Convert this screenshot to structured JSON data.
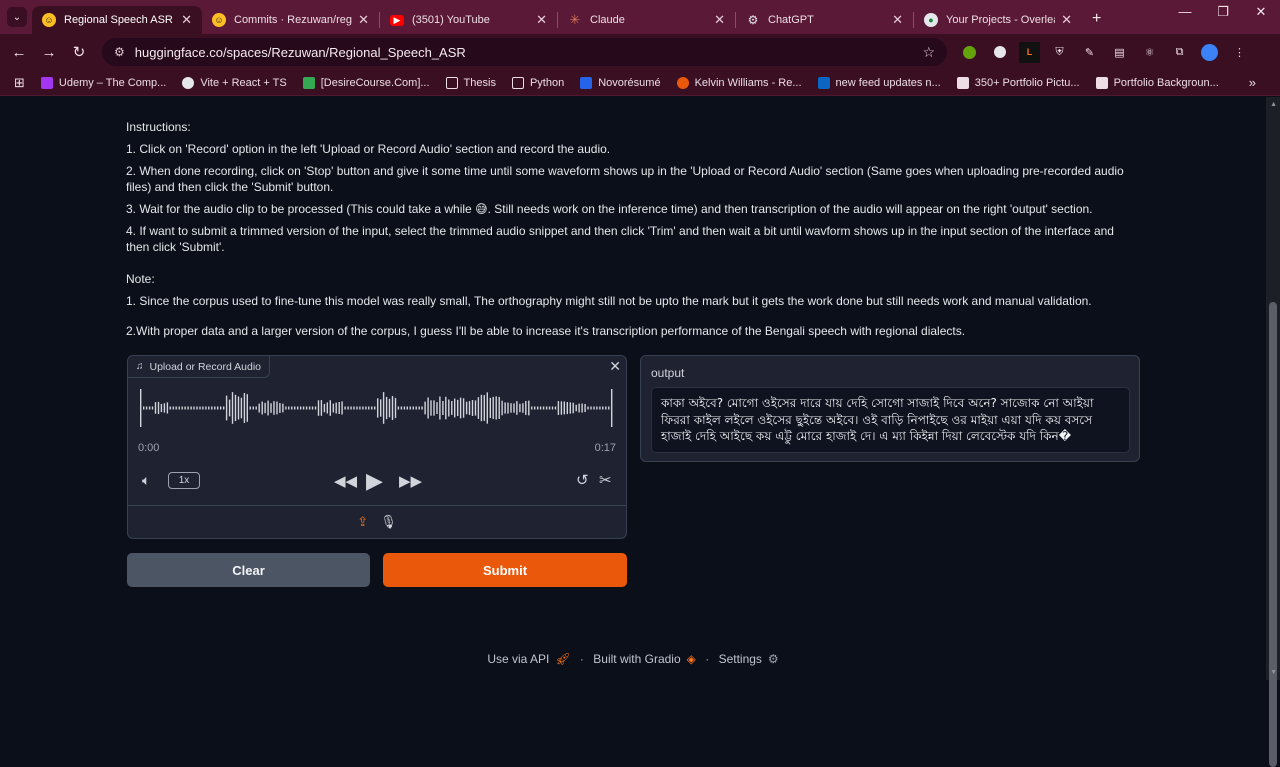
{
  "browser": {
    "tabs": [
      {
        "title": "Regional Speech ASR - a H",
        "favicon": "hf",
        "active": true
      },
      {
        "title": "Commits · Rezuwan/regior",
        "favicon": "hf",
        "active": false
      },
      {
        "title": "(3501) YouTube",
        "favicon": "yt",
        "active": false
      },
      {
        "title": "Claude",
        "favicon": "claude",
        "active": false
      },
      {
        "title": "ChatGPT",
        "favicon": "gpt",
        "active": false
      },
      {
        "title": "Your Projects - Overleaf, O",
        "favicon": "overleaf",
        "active": false
      }
    ],
    "new_tab_glyph": "+",
    "url": "huggingface.co/spaces/Rezuwan/Regional_Speech_ASR",
    "bookmarks": [
      {
        "label": "Udemy – The Comp...",
        "color": "#a435f0"
      },
      {
        "label": "Vite + React + TS",
        "color": "#e5e7eb"
      },
      {
        "label": "[DesireCourse.Com]...",
        "color": "#34a853"
      },
      {
        "label": "Thesis",
        "color": "folder"
      },
      {
        "label": "Python",
        "color": "folder"
      },
      {
        "label": "Novorésumé",
        "color": "#2563eb"
      },
      {
        "label": "Kelvin Williams - Re...",
        "color": "#ea580c"
      },
      {
        "label": "new feed updates n...",
        "color": "#0a66c2"
      },
      {
        "label": "350+ Portfolio Pictu...",
        "color": "#222222"
      },
      {
        "label": "Portfolio Backgroun...",
        "color": "#222222"
      }
    ]
  },
  "instructions": {
    "heading": "Instructions:",
    "steps": [
      "1. Click on 'Record' option in the left 'Upload or Record Audio' section and record the audio.",
      "2. When done recording, click on 'Stop' button and give it some time until some waveform shows up in the 'Upload or Record Audio' section (Same goes when uploading pre-recorded audio files) and then click the 'Submit' button.",
      "3. Wait for the audio clip to be processed (This could take a while 😅. Still needs work on the inference time) and then transcription of the audio will appear on the right 'output' section.",
      "4. If want to submit a trimmed version of the input, select the trimmed audio snippet and then click 'Trim' and then wait a bit until wavform shows up in the input section of the interface and then click 'Submit'."
    ],
    "note_heading": "Note:",
    "notes": [
      "1. Since the corpus used to fine-tune this model was really small, The orthography might still not be upto the mark but it gets the work done but still needs work and manual validation.",
      "2.With proper data and a larger version of the corpus, I guess I'll be able to increase it's transcription performance of the Bengali speech with regional dialects."
    ]
  },
  "audio": {
    "label": "Upload or Record Audio",
    "time_start": "0:00",
    "time_end": "0:17",
    "speed": "1x"
  },
  "output": {
    "label": "output",
    "text": "কাকা অইবে? মোগো ওইসের দারে যায় দেহি সোগো সাজাই দিবে অনে? সাজোক নো আইয়া ফিররা কাইল লইলে ওইসের ছুইন্তে অইবে। ওই বাড়ি নিপাইছে ওর মাইয়া এয়া যদি কয় বসসে হাজাই দেহি আইছে কয় এট্টু মোরে হাজাই দে। এ ম্যা কিইন্না দিয়া লেবেস্টেক যদি কিন�"
  },
  "buttons": {
    "clear": "Clear",
    "submit": "Submit"
  },
  "footer": {
    "api": "Use via API",
    "sep": "·",
    "built": "Built with Gradio",
    "settings": "Settings"
  },
  "colors": {
    "accent": "#ea580c",
    "tab_bg": "#5a1936",
    "toolbar_bg": "#3a0f22",
    "page_bg": "#0b0f19"
  }
}
